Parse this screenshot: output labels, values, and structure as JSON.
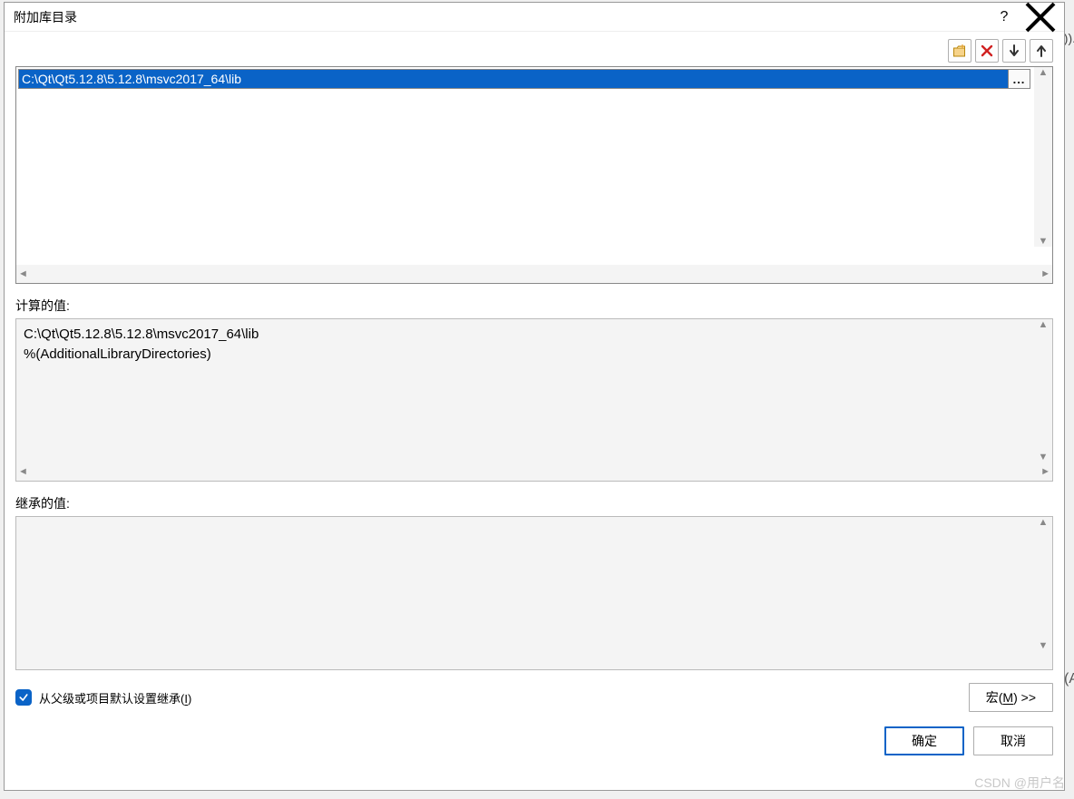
{
  "dialog": {
    "title": "附加库目录",
    "help_label": "?",
    "close_label": "✕"
  },
  "toolbar": {
    "new_folder": "new-folder",
    "delete": "delete",
    "move_down": "down",
    "move_up": "up"
  },
  "entries": {
    "items": [
      {
        "path": "C:\\Qt\\Qt5.12.8\\5.12.8\\msvc2017_64\\lib"
      }
    ],
    "browse_label": "..."
  },
  "computed": {
    "label": "计算的值:",
    "lines": "C:\\Qt\\Qt5.12.8\\5.12.8\\msvc2017_64\\lib\n%(AdditionalLibraryDirectories)"
  },
  "inherited": {
    "label": "继承的值:",
    "lines": ""
  },
  "inherit_checkbox": {
    "checked": true,
    "label_pre": "从父级或项目默认设置继承(",
    "accel": "I",
    "label_post": ")"
  },
  "macro_btn": {
    "pre": "宏(",
    "accel": "M",
    "post": ") >>"
  },
  "buttons": {
    "ok": "确定",
    "cancel": "取消"
  },
  "background": {
    "frag1": ")).",
    "frag2": "(A"
  },
  "watermark": "CSDN @用户名"
}
